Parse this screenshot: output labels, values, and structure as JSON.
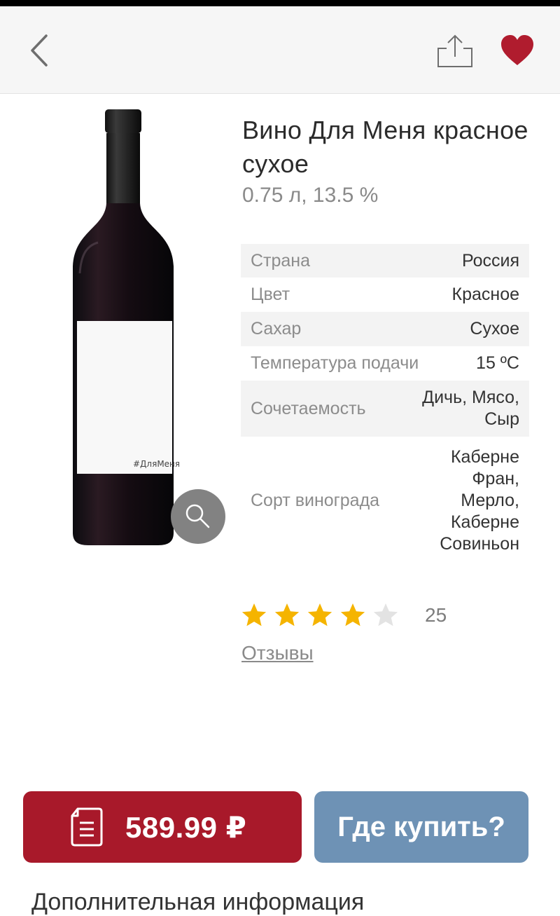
{
  "product": {
    "title": "Вино Для Меня красное сухое",
    "subtitle": "0.75 л, 13.5 %",
    "label_text": "#ДляМеня"
  },
  "specs": [
    {
      "key": "Страна",
      "value": "Россия"
    },
    {
      "key": "Цвет",
      "value": "Красное"
    },
    {
      "key": "Сахар",
      "value": "Сухое"
    },
    {
      "key": "Температура подачи",
      "value": "15 ºС"
    },
    {
      "key": "Сочетаемость",
      "value": "Дичь, Мясо, Сыр"
    },
    {
      "key": "Сорт винограда",
      "value": "Каберне Фран, Мерло, Каберне Совиньон"
    }
  ],
  "rating": {
    "value": 4,
    "max": 5,
    "count": "25"
  },
  "reviews_link": "Отзывы",
  "buttons": {
    "price": "589.99 ₽",
    "where_to_buy": "Где купить?"
  },
  "more_info": "Дополнительная информация",
  "colors": {
    "price_button": "#a8192a",
    "where_button": "#6e92b5",
    "heart": "#b01c2e",
    "star_filled": "#f5b400",
    "star_empty": "#e3e3e3"
  },
  "icons": {
    "back": "chevron-left-icon",
    "share": "share-icon",
    "favorite": "heart-icon",
    "zoom": "magnifier-icon",
    "receipt": "receipt-icon"
  }
}
